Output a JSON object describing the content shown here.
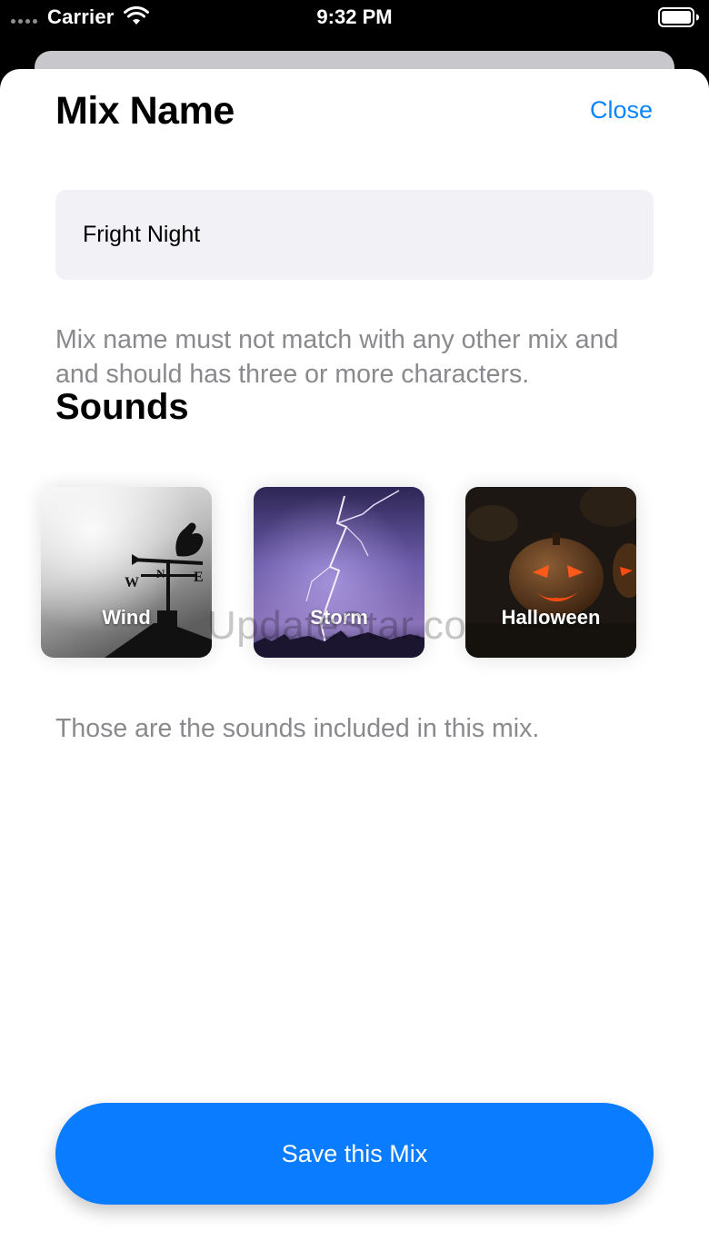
{
  "status_bar": {
    "carrier": "Carrier",
    "time": "9:32 PM"
  },
  "sheet": {
    "title": "Mix Name",
    "close_label": "Close",
    "name_input_value": "Fright Night",
    "name_hint": "Mix name must not match with any other mix and and should has three or more characters.",
    "sounds_title": "Sounds",
    "sounds": [
      {
        "label": "Wind"
      },
      {
        "label": "Storm"
      },
      {
        "label": "Halloween"
      }
    ],
    "sounds_hint": "Those are the sounds included in this mix.",
    "save_label": "Save this Mix"
  },
  "watermark": "UpdateStar.co",
  "colors": {
    "accent": "#0a84ff",
    "button": "#0a7cff",
    "input_bg": "#f1f1f6",
    "hint_text": "#8a8a8e"
  }
}
